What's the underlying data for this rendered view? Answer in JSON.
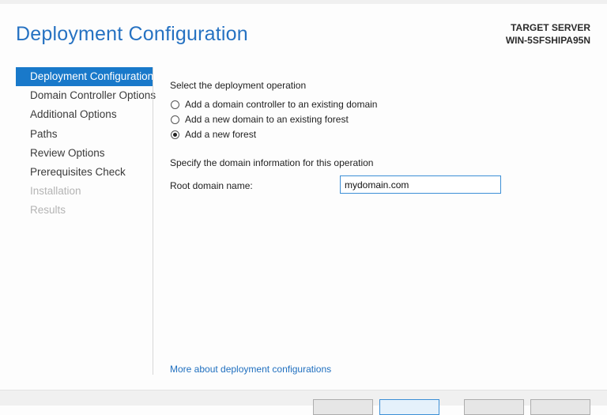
{
  "header": {
    "title": "Deployment Configuration",
    "target_label": "TARGET SERVER",
    "target_name": "WIN-5SFSHIPA95N"
  },
  "nav": {
    "items": [
      {
        "label": "Deployment Configuration",
        "state": "active"
      },
      {
        "label": "Domain Controller Options",
        "state": "enabled"
      },
      {
        "label": "Additional Options",
        "state": "enabled"
      },
      {
        "label": "Paths",
        "state": "enabled"
      },
      {
        "label": "Review Options",
        "state": "enabled"
      },
      {
        "label": "Prerequisites Check",
        "state": "enabled"
      },
      {
        "label": "Installation",
        "state": "disabled"
      },
      {
        "label": "Results",
        "state": "disabled"
      }
    ]
  },
  "operation": {
    "heading": "Select the deployment operation",
    "options": [
      {
        "label": "Add a domain controller to an existing domain",
        "checked": false
      },
      {
        "label": "Add a new domain to an existing forest",
        "checked": false
      },
      {
        "label": "Add a new forest",
        "checked": true
      }
    ]
  },
  "domain": {
    "heading": "Specify the domain information for this operation",
    "root_label": "Root domain name:",
    "root_value": "mydomain.com"
  },
  "links": {
    "more": "More about deployment configurations"
  },
  "colors": {
    "accent": "#1979ca",
    "title": "#2672c2",
    "link": "#1f6fbf",
    "disabled_text": "#b4b4b4"
  }
}
